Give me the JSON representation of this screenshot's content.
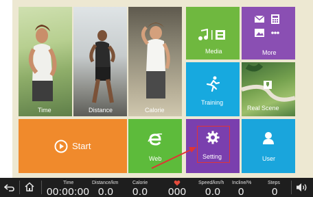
{
  "tiles": {
    "time": "Time",
    "distance": "Distance",
    "calorie": "Calorie",
    "media": "Media",
    "more": "More",
    "training": "Training",
    "real_scene": "Real Scene",
    "start": "Start",
    "web": "Web",
    "setting": "Setting",
    "user": "User"
  },
  "colors": {
    "media_green": "#6fb83f",
    "more_purple": "#8a4fb3",
    "training_blue": "#17a9df",
    "start_orange": "#f08a2c",
    "web_green": "#5dbb3b",
    "setting_purple": "#7a3fae",
    "user_blue": "#1aa5dc",
    "highlight_red": "#e03434",
    "bar_bg": "#1e1e1e"
  },
  "status_bar": {
    "time_label": "Time",
    "time_value": "00:00:00",
    "distance_label": "Distance/km",
    "distance_value": "0.0",
    "calorie_label": "Calorie",
    "calorie_value": "0.0",
    "heart_value": "000",
    "speed_label": "Speed/km/h",
    "speed_value": "0.0",
    "incline_label": "Incline/%",
    "incline_value": "0",
    "steps_label": "Steps",
    "steps_value": "0"
  },
  "icons": [
    "back-icon",
    "home-icon",
    "heart-icon",
    "volume-icon",
    "music-icon",
    "film-icon",
    "mail-icon",
    "calculator-icon",
    "image-icon",
    "dots-icon",
    "runner-icon",
    "map-pin-icon",
    "play-circle-icon",
    "browser-e-icon",
    "gear-icon",
    "user-icon"
  ]
}
